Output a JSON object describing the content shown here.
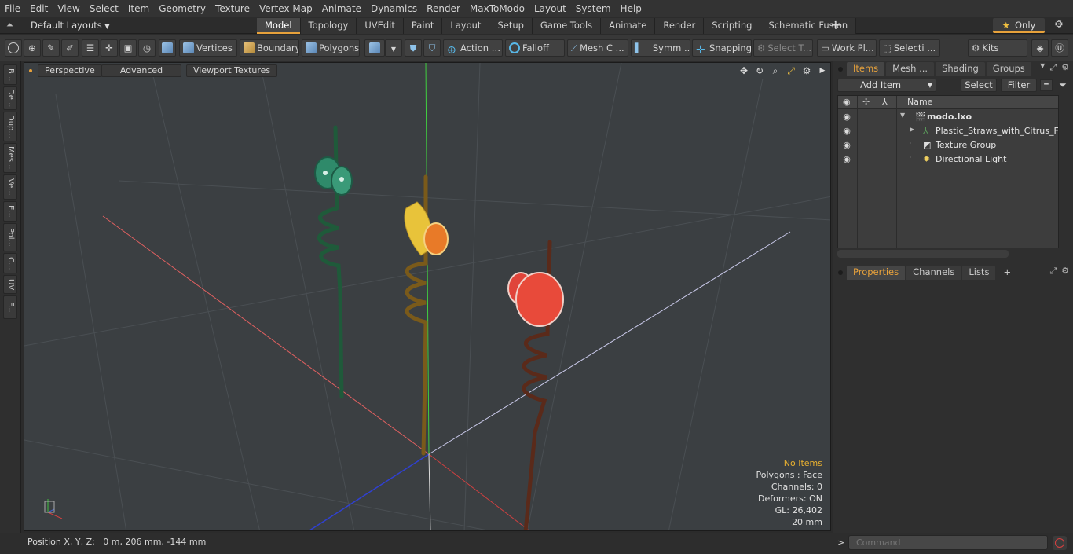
{
  "menu": [
    "File",
    "Edit",
    "View",
    "Select",
    "Item",
    "Geometry",
    "Texture",
    "Vertex Map",
    "Animate",
    "Dynamics",
    "Render",
    "MaxToModo",
    "Layout",
    "System",
    "Help"
  ],
  "layout": {
    "select_label": "Default Layouts",
    "tabs": [
      {
        "label": "Model",
        "active": true
      },
      {
        "label": "Topology"
      },
      {
        "label": "UVEdit"
      },
      {
        "label": "Paint"
      },
      {
        "label": "Layout"
      },
      {
        "label": "Setup"
      },
      {
        "label": "Game Tools"
      },
      {
        "label": "Animate"
      },
      {
        "label": "Render"
      },
      {
        "label": "Scripting"
      },
      {
        "label": "Schematic Fusion"
      }
    ],
    "add_tab": "+",
    "only_label": "Only"
  },
  "toolbar": {
    "vertices": "Vertices",
    "boundary": "Boundary",
    "polygons": "Polygons",
    "action": "Action",
    "falloff": "Falloff",
    "mesh": "Mesh C ...",
    "symm": "Symm ...",
    "snapping": "Snapping",
    "select_t": "Select T...",
    "work_pl": "Work Pl...",
    "selecti": "Selecti ...",
    "kits": "Kits"
  },
  "left_strip": [
    "B...",
    "De...",
    "Dup...",
    "Mes...",
    "Ve...",
    "E...",
    "Pol...",
    "C...",
    "UV",
    "F..."
  ],
  "viewport": {
    "buttons": [
      "Perspective",
      "Advanced",
      "Viewport Textures"
    ],
    "info": {
      "no_items": "No Items",
      "polygons": "Polygons : Face",
      "channels": "Channels: 0",
      "deformers": "Deformers: ON",
      "gl": "GL: 26,402",
      "scale": "20 mm"
    }
  },
  "status": {
    "position": "Position X, Y, Z:   0 m, 206 mm, -144 mm"
  },
  "items_panel": {
    "tabs": [
      "Items",
      "Mesh ...",
      "Shading",
      "Groups"
    ],
    "add_item": "Add Item",
    "select": "Select",
    "filter": "Filter",
    "column_name": "Name",
    "rows": [
      {
        "label": "modo.lxo",
        "bold": true
      },
      {
        "label": "Plastic_Straws_with_Citrus_F..."
      },
      {
        "label": "Texture Group"
      },
      {
        "label": "Directional Light"
      }
    ]
  },
  "props_panel": {
    "tabs": [
      "Properties",
      "Channels",
      "Lists"
    ],
    "add": "+"
  },
  "command": {
    "placeholder": "Command"
  },
  "colors": {
    "accent": "#e8a23b",
    "viewport_bg": "#3b3f42",
    "axis_x": "#d04040",
    "axis_y": "#40d040",
    "axis_z": "#3040d0"
  }
}
